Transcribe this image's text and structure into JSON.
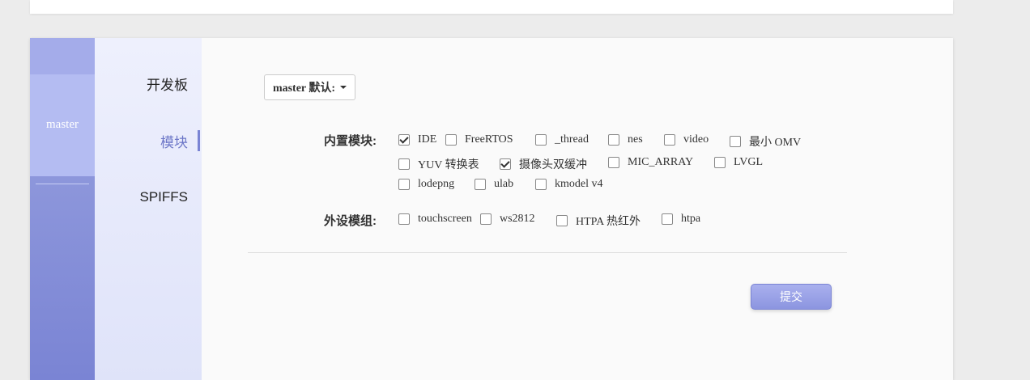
{
  "rail": {
    "active_label": "master"
  },
  "subnav": {
    "items": [
      "开发板",
      "模块",
      "SPIFFS"
    ],
    "active_index": 1
  },
  "branch_dropdown": {
    "label": "master 默认:"
  },
  "builtin_modules": {
    "label": "内置模块:",
    "options": [
      {
        "label": "IDE",
        "checked": true
      },
      {
        "label": "FreeRTOS",
        "checked": false
      },
      {
        "label": "_thread",
        "checked": false
      },
      {
        "label": "nes",
        "checked": false
      },
      {
        "label": "video",
        "checked": false
      },
      {
        "label": "最小 OMV",
        "checked": false
      },
      {
        "label": "YUV 转换表",
        "checked": false
      },
      {
        "label": "摄像头双缓冲",
        "checked": true
      },
      {
        "label": "MIC_ARRAY",
        "checked": false
      },
      {
        "label": "LVGL",
        "checked": false
      },
      {
        "label": "lodepng",
        "checked": false
      },
      {
        "label": "ulab",
        "checked": false
      },
      {
        "label": "kmodel v4",
        "checked": false
      }
    ]
  },
  "peripheral_modules": {
    "label": "外设模组:",
    "options": [
      {
        "label": "touchscreen",
        "checked": false
      },
      {
        "label": "ws2812",
        "checked": false
      },
      {
        "label": "HTPA 热红外",
        "checked": false
      },
      {
        "label": "htpa",
        "checked": false
      }
    ]
  },
  "submit": {
    "label": "提交"
  },
  "colors": {
    "accent": "#7a84d4",
    "rail": "#8c95e0"
  }
}
